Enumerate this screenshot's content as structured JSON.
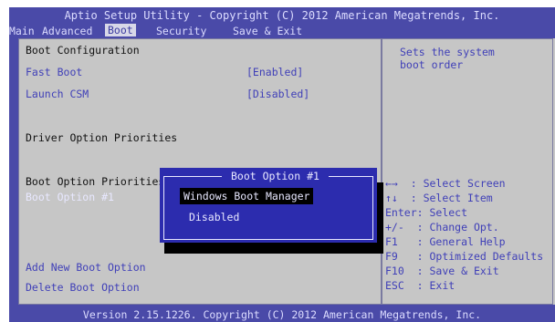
{
  "header": {
    "title": "Aptio Setup Utility - Copyright (C) 2012 American Megatrends, Inc."
  },
  "menu": [
    {
      "label": "Main",
      "active": false
    },
    {
      "label": "Advanced",
      "active": false
    },
    {
      "label": "Boot",
      "active": true
    },
    {
      "label": "Security",
      "active": false
    },
    {
      "label": "Save & Exit",
      "active": false
    }
  ],
  "main": {
    "section_title": "Boot Configuration",
    "fast_boot_label": "Fast Boot",
    "fast_boot_value": "[Enabled]",
    "launch_csm_label": "Launch CSM",
    "launch_csm_value": "[Disabled]",
    "driver_option_priorities": "Driver Option Priorities",
    "boot_option_priorities": "Boot Option Priorities",
    "boot_option_1_label": "Boot Option #1",
    "add_new_boot_option": "Add New Boot Option",
    "delete_boot_option": "Delete Boot Option"
  },
  "help": {
    "description_line1": "Sets the system",
    "description_line2": "boot order",
    "keys": [
      {
        "key": "←→",
        "text": ": Select Screen"
      },
      {
        "key": "↑↓",
        "text": ": Select Item"
      },
      {
        "key": "Enter",
        "text": ": Select"
      },
      {
        "key": "+/-",
        "text": ": Change Opt."
      },
      {
        "key": "F1",
        "text": ": General Help"
      },
      {
        "key": "F9",
        "text": ": Optimized Defaults"
      },
      {
        "key": "F10",
        "text": ": Save & Exit"
      },
      {
        "key": "ESC",
        "text": ": Exit"
      }
    ]
  },
  "popup": {
    "title": "Boot Option #1",
    "options": [
      "Windows Boot Manager",
      "Disabled"
    ],
    "selected": "Windows Boot Manager"
  },
  "footer": {
    "version": "Version 2.15.1226. Copyright (C) 2012 American Megatrends, Inc."
  },
  "colors": {
    "background": "#4a4aa8",
    "panel": "#c6c6c6",
    "option_text": "#4040b8",
    "popup": "#2c2cae"
  }
}
